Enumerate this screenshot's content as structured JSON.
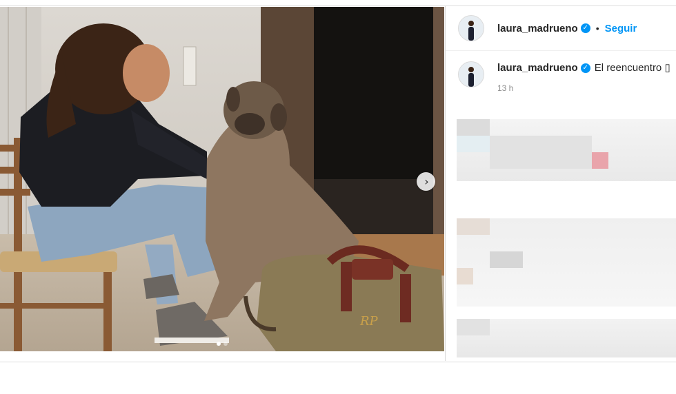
{
  "post": {
    "username": "laura_madrueno",
    "separator": "•",
    "follow_label": "Seguir",
    "caption_text": "El reencuentro ▯",
    "timestamp": "13 h",
    "verified_glyph": "✓",
    "next_icon_glyph": "›",
    "media_alt": "Mujer sentada en una silla acariciando a un perro grande junto a una bolsa de viaje",
    "bag_monogram": "RP",
    "carousel": {
      "count": 2,
      "active": 1
    }
  },
  "icons": {
    "verified": "verified-badge-icon",
    "next": "chevron-right-icon"
  },
  "colors": {
    "accent": "#0095f6",
    "text": "#262626",
    "muted": "#8e8e8e",
    "border": "#dbdbdb"
  }
}
